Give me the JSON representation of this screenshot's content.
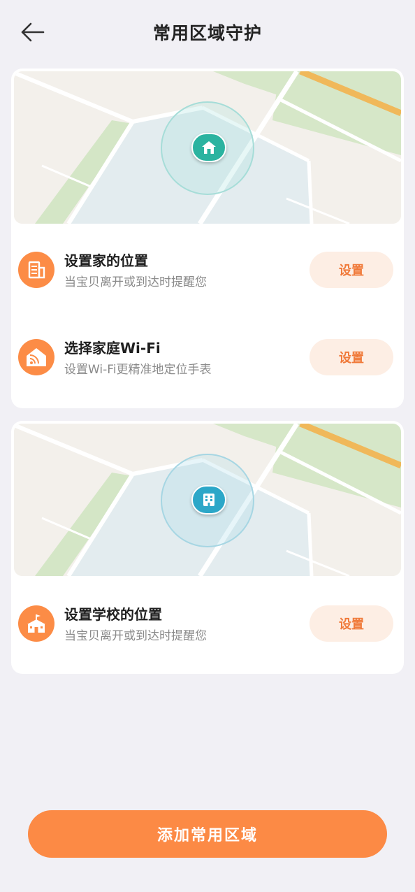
{
  "header": {
    "title": "常用区域守护",
    "back_icon": "arrow-left-icon"
  },
  "home_card": {
    "map_marker_icon": "home-icon",
    "rows": [
      {
        "icon": "building-icon",
        "title": "设置家的位置",
        "subtitle": "当宝贝离开或到达时提醒您",
        "button": "设置"
      },
      {
        "icon": "home-wifi-icon",
        "title": "选择家庭Wi-Fi",
        "subtitle": "设置Wi-Fi更精准地定位手表",
        "button": "设置"
      }
    ]
  },
  "school_card": {
    "map_marker_icon": "school-building-icon",
    "rows": [
      {
        "icon": "school-icon",
        "title": "设置学校的位置",
        "subtitle": "当宝贝离开或到达时提醒您",
        "button": "设置"
      }
    ]
  },
  "footer": {
    "add_button": "添加常用区域"
  },
  "colors": {
    "accent": "#fc8a45",
    "accent_light": "#fdeee4",
    "home_marker": "#2bb3a0",
    "school_marker": "#2ca7c8",
    "background": "#f1f0f5"
  }
}
